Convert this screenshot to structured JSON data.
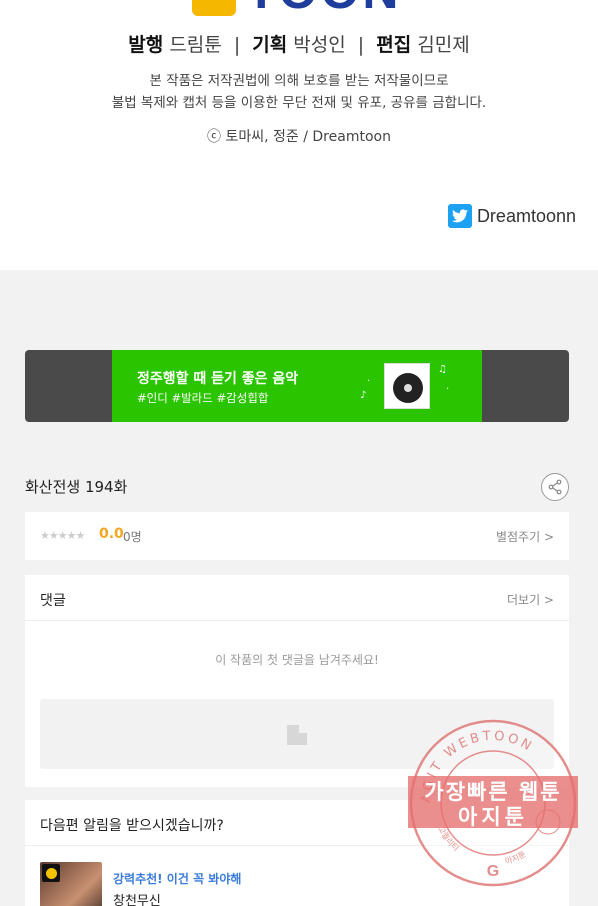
{
  "credits": {
    "logo_text": "TOON",
    "publisher_label": "발행",
    "publisher": "드림툰",
    "planner_label": "기획",
    "planner": "박성인",
    "editor_label": "편집",
    "editor": "김민제",
    "notice_line1": "본 작품은 저작권법에 의해 보호를 받는 저작물이므로",
    "notice_line2": "불법 복제와 캡처 등을 이용한 무단 전재 및 유포, 공유를 금합니다.",
    "copyright": "ⓒ 토마씨, 정준 / Dreamtoon",
    "twitter_handle": "Dreamtoonn"
  },
  "banner": {
    "title": "정주행할 때 듣기 좋은 음악",
    "tags": "#인디 #발라드 #감성힙합"
  },
  "episode": {
    "title": "화산전생 194화"
  },
  "rating": {
    "stars": "★★★★★",
    "score": "0.0",
    "count": "0명",
    "rate_link": "별점주기 >"
  },
  "comments": {
    "title": "댓글",
    "more": "더보기 >",
    "empty_message": "이 작품의 첫 댓글을 남겨주세요!"
  },
  "notify": {
    "title": "다음편 알림을 받으시겠습니까?",
    "rec_label": "강력추천! 이건 꼭 봐야해",
    "rec_title": "창천무신"
  },
  "watermark": {
    "ring_top": "AGIT WEBTOON",
    "band_line1": "가장빠른 웹툰",
    "band_line2": "아지툰",
    "ring_bottom_left": "고퀄리티",
    "ring_bottom_right": "아지툰"
  },
  "colors": {
    "accent_green": "#2bc400",
    "score_orange": "#f5a623",
    "link_blue": "#3a7cd9",
    "twitter_blue": "#1da1f2",
    "stamp_red": "#e06666"
  }
}
